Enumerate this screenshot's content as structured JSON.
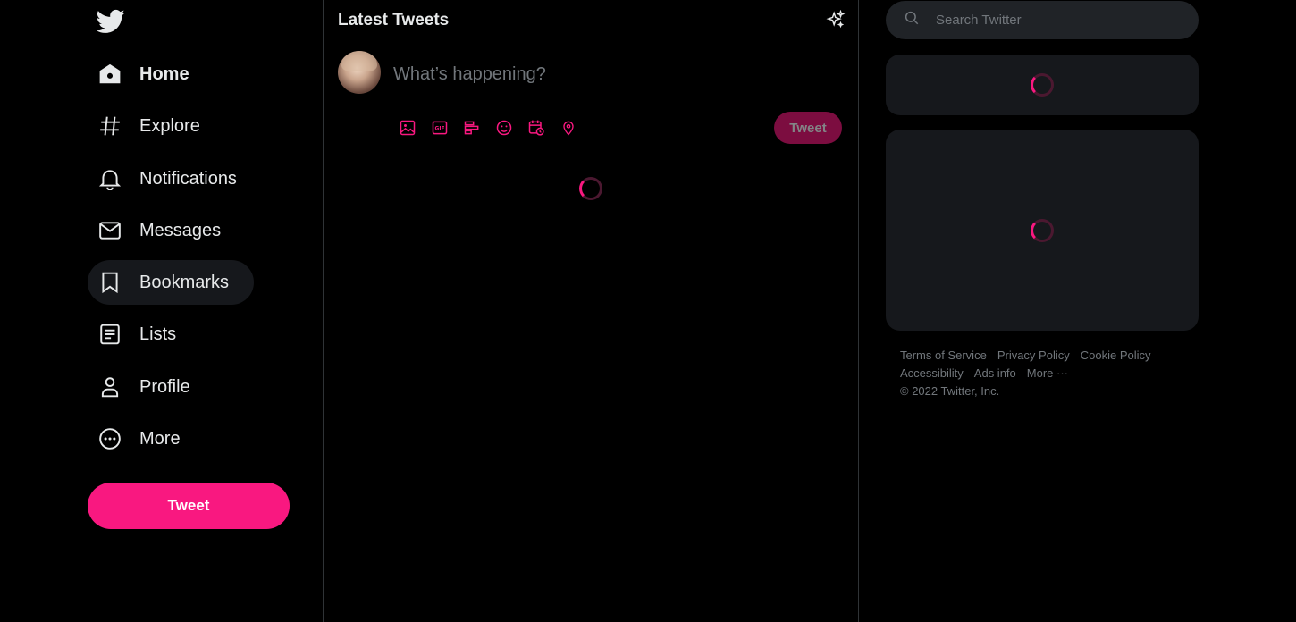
{
  "nav": {
    "items": [
      {
        "label": "Home",
        "icon": "home-icon"
      },
      {
        "label": "Explore",
        "icon": "hashtag-icon"
      },
      {
        "label": "Notifications",
        "icon": "bell-icon"
      },
      {
        "label": "Messages",
        "icon": "envelope-icon"
      },
      {
        "label": "Bookmarks",
        "icon": "bookmark-icon"
      },
      {
        "label": "Lists",
        "icon": "list-icon"
      },
      {
        "label": "Profile",
        "icon": "person-icon"
      },
      {
        "label": "More",
        "icon": "more-circle-icon"
      }
    ],
    "tweet_label": "Tweet"
  },
  "main": {
    "title": "Latest Tweets",
    "compose_placeholder": "What’s happening?",
    "tweet_label": "Tweet",
    "tools": [
      "image-icon",
      "gif-icon",
      "poll-icon",
      "emoji-icon",
      "schedule-icon",
      "location-icon"
    ]
  },
  "right": {
    "search_placeholder": "Search Twitter",
    "footer": {
      "links": [
        "Terms of Service",
        "Privacy Policy",
        "Cookie Policy",
        "Accessibility",
        "Ads info",
        "More ···"
      ],
      "copyright": "© 2022 Twitter, Inc."
    }
  },
  "colors": {
    "accent": "#f91880",
    "background": "#000000",
    "card": "#16181c",
    "border": "#2f3336",
    "muted_text": "#71767b"
  }
}
